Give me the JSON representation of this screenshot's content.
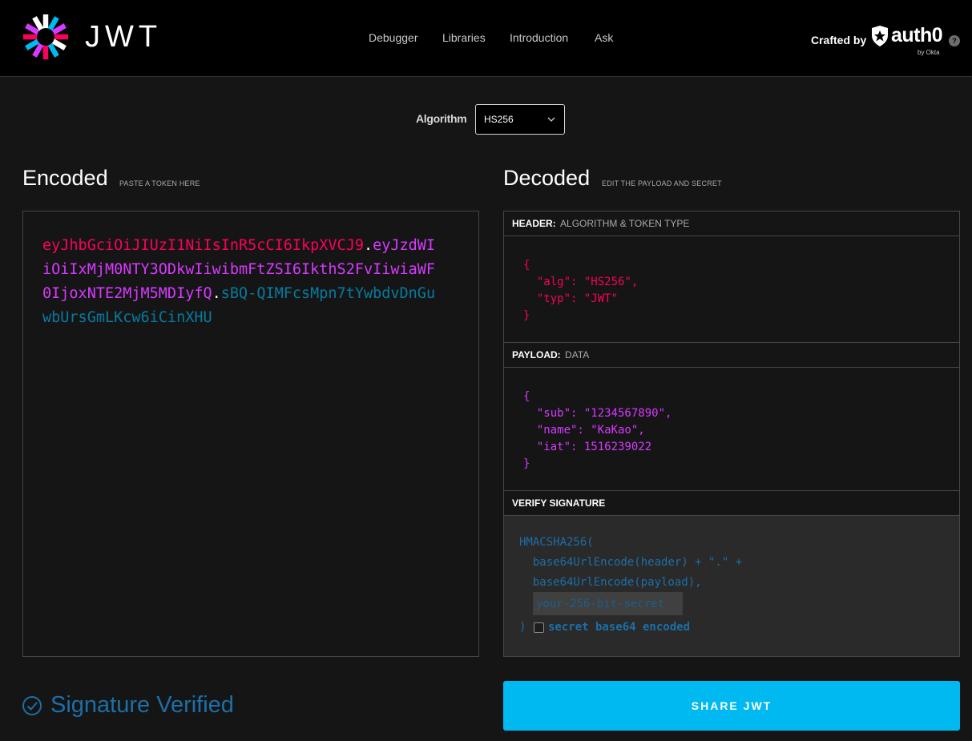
{
  "brand": {
    "logo_text": "JWT"
  },
  "nav": {
    "items": [
      "Debugger",
      "Libraries",
      "Introduction",
      "Ask"
    ]
  },
  "crafted": {
    "label": "Crafted by",
    "brand": "auth0",
    "byline": "by Okta",
    "help": "?"
  },
  "algorithm": {
    "label": "Algorithm",
    "selected": "HS256"
  },
  "encoded": {
    "title": "Encoded",
    "hint": "PASTE A TOKEN HERE",
    "token_header": "eyJhbGciOiJIUzI1NiIsInR5cCI6IkpXVCJ9",
    "token_payload": "eyJzdWIiOiIxMjM0NTY3ODkwIiwibmFtZSI6IkthS2FvIiwiaWF0IjoxNTE2MjM5MDIyfQ",
    "token_signature": "sBQ-QIMFcsMpn7tYwbdvDnGuwbUrsGmLKcw6iCinXHU",
    "dot": "."
  },
  "decoded": {
    "title": "Decoded",
    "hint": "EDIT THE PAYLOAD AND SECRET",
    "header_section": {
      "label": "HEADER:",
      "sub": "ALGORITHM & TOKEN TYPE"
    },
    "header_json": "{\n  \"alg\": \"HS256\",\n  \"typ\": \"JWT\"\n}",
    "payload_section": {
      "label": "PAYLOAD:",
      "sub": "DATA"
    },
    "payload_json": "{\n  \"sub\": \"1234567890\",\n  \"name\": \"KaKao\",\n  \"iat\": 1516239022\n}",
    "verify_section": {
      "label": "VERIFY SIGNATURE"
    },
    "verify": {
      "line1": "HMACSHA256(",
      "line2": "  base64UrlEncode(header) + \".\" +",
      "line3": "  base64UrlEncode(payload),",
      "secret_placeholder": "your-256-bit-secret",
      "close": ")",
      "base64_label": "secret base64 encoded"
    }
  },
  "status": {
    "text": "Signature Verified"
  },
  "share": {
    "label": "SHARE JWT"
  },
  "colors": {
    "header_token": "#fb015b",
    "payload_token": "#d63aff",
    "signature_token": "#00b9f1",
    "verified": "#1c6fa8",
    "share_button": "#00b9f1"
  }
}
